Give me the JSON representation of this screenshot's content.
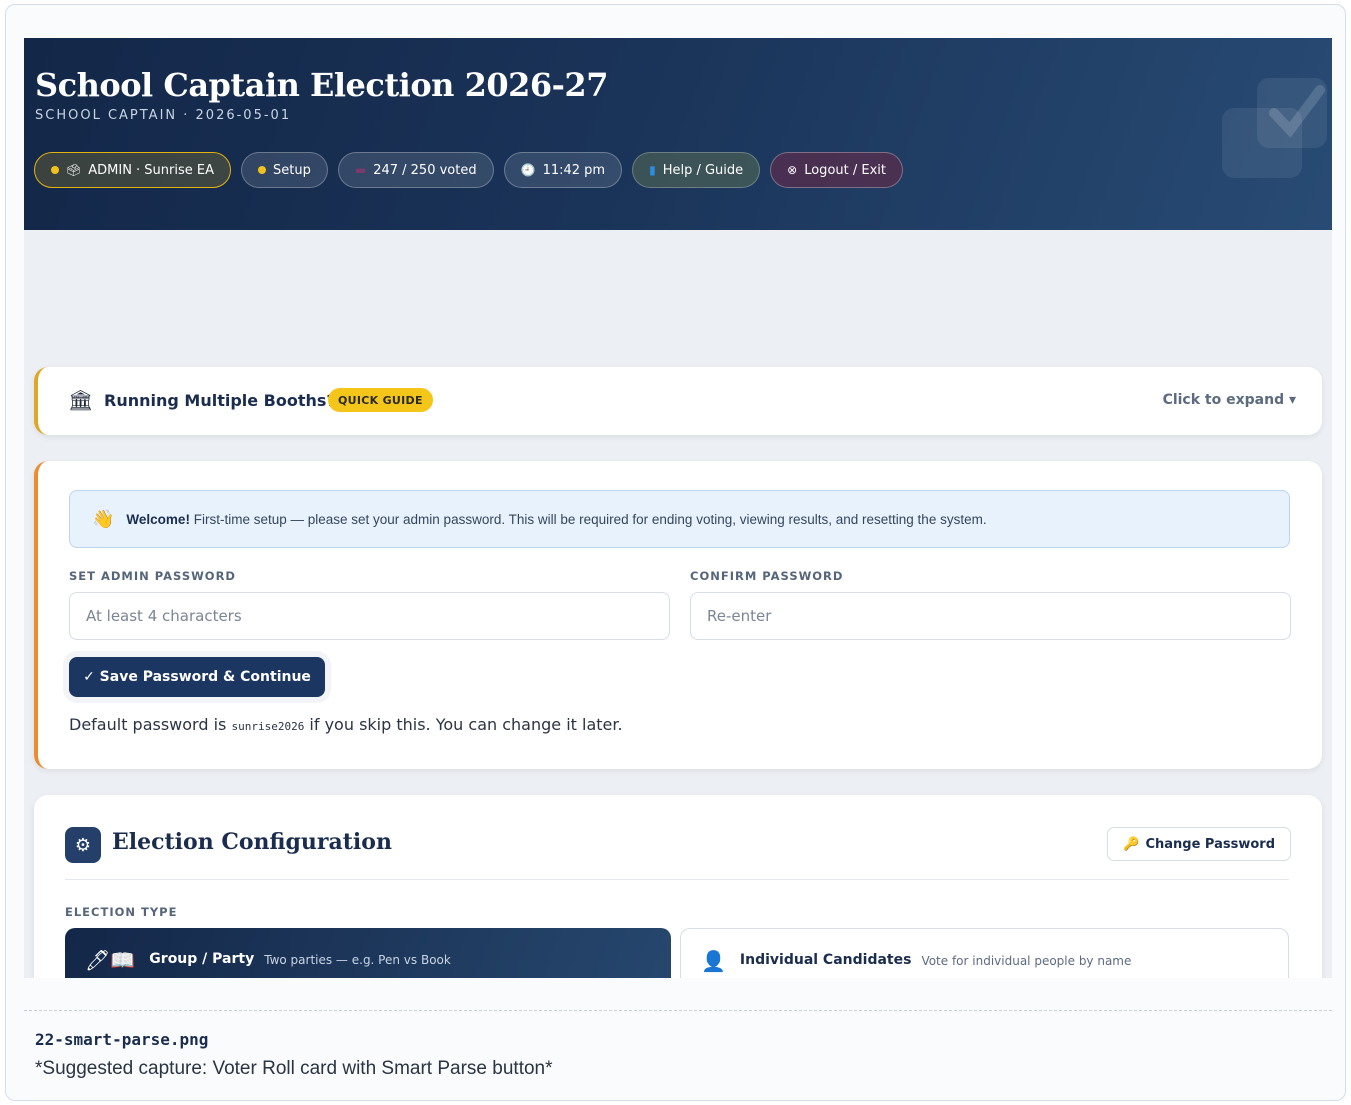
{
  "header": {
    "title": "School Captain Election 2026-27",
    "subtitle": "SCHOOL CAPTAIN · 2026-05-01",
    "pills": {
      "admin": "ADMIN · Sunrise EA",
      "setup": "Setup",
      "votes": "247 / 250 voted",
      "time": "11:42 pm",
      "help": "Help / Guide",
      "logout": "Logout / Exit"
    }
  },
  "booths": {
    "title": "Running Multiple Booths?",
    "badge": "QUICK GUIDE",
    "expand": "Click to expand ▾"
  },
  "setup": {
    "welcome_bold": "Welcome!",
    "welcome_text": "First-time setup — please set your admin password. This will be required for ending voting, viewing results, and resetting the system.",
    "password_label": "SET ADMIN PASSWORD",
    "password_placeholder": "At least 4 characters",
    "confirm_label": "CONFIRM PASSWORD",
    "confirm_placeholder": "Re-enter",
    "save_button": "✓ Save Password & Continue",
    "default_prefix": "Default password is",
    "default_password": "sunrise2026",
    "default_suffix": "if you skip this. You can change it later."
  },
  "config": {
    "title": "Election Configuration",
    "change_password": "Change Password",
    "election_type_label": "ELECTION TYPE",
    "options": [
      {
        "name": "Group / Party",
        "desc": "Two parties — e.g. Pen vs Book",
        "selected": true
      },
      {
        "name": "Individual Candidates",
        "desc": "Vote for individual people by name",
        "selected": false
      }
    ]
  },
  "caption": {
    "filename": "22-smart-parse.png",
    "text": "*Suggested capture: Voter Roll card with Smart Parse button*"
  },
  "colors": {
    "navy": "#1b3660",
    "header_gradient_start": "#132748",
    "accent_yellow": "#f5c61a",
    "accent_orange": "#ef8a2e"
  },
  "icons": {
    "admin": "ballot-box-icon",
    "votes": "ballot-icon",
    "time": "clock-icon",
    "help": "book-icon",
    "logout": "circle-x-icon",
    "booths": "bank-icon",
    "welcome": "waving-hand-icon",
    "config": "gear-icon",
    "change_password": "key-icon",
    "group": "pen-book-icon",
    "individual": "person-icon"
  }
}
